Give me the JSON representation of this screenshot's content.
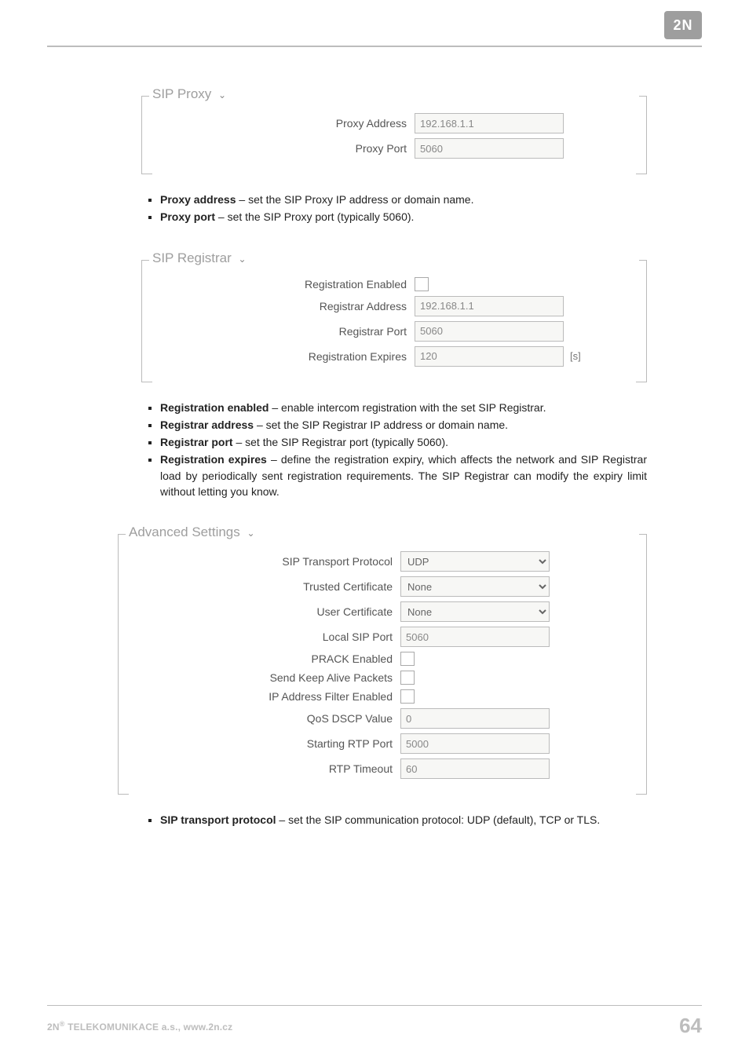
{
  "brand": {
    "logo_text": "2N"
  },
  "sections": {
    "sip_proxy": {
      "title": "SIP Proxy",
      "fields": {
        "proxy_address_label": "Proxy Address",
        "proxy_address_value": "192.168.1.1",
        "proxy_port_label": "Proxy Port",
        "proxy_port_value": "5060"
      },
      "desc": [
        {
          "term": "Proxy address",
          "text": " – set the SIP Proxy IP address or domain name."
        },
        {
          "term": "Proxy port",
          "text": " – set the SIP Proxy port (typically 5060)."
        }
      ]
    },
    "sip_registrar": {
      "title": "SIP Registrar",
      "fields": {
        "registration_enabled_label": "Registration Enabled",
        "registrar_address_label": "Registrar Address",
        "registrar_address_value": "192.168.1.1",
        "registrar_port_label": "Registrar Port",
        "registrar_port_value": "5060",
        "registration_expires_label": "Registration Expires",
        "registration_expires_value": "120",
        "registration_expires_suffix": "[s]"
      },
      "desc": [
        {
          "term": "Registration enabled",
          "text": " – enable intercom registration with the set SIP Registrar."
        },
        {
          "term": "Registrar address",
          "text": " – set the SIP Registrar IP address or domain name."
        },
        {
          "term": "Registrar port",
          "text": " – set the SIP Registrar port (typically 5060)."
        },
        {
          "term": "Registration expires",
          "text": " – define the registration expiry, which affects the network and SIP Registrar load by periodically sent registration requirements. The SIP Registrar can modify the expiry limit without letting you know."
        }
      ]
    },
    "advanced": {
      "title": "Advanced Settings",
      "fields": {
        "sip_transport_label": "SIP Transport Protocol",
        "sip_transport_value": "UDP",
        "trusted_cert_label": "Trusted Certificate",
        "trusted_cert_value": "None",
        "user_cert_label": "User Certificate",
        "user_cert_value": "None",
        "local_sip_port_label": "Local SIP Port",
        "local_sip_port_value": "5060",
        "prack_enabled_label": "PRACK Enabled",
        "keep_alive_label": "Send Keep Alive Packets",
        "ip_filter_label": "IP Address Filter Enabled",
        "qos_dscp_label": "QoS DSCP Value",
        "qos_dscp_value": "0",
        "starting_rtp_label": "Starting RTP Port",
        "starting_rtp_value": "5000",
        "rtp_timeout_label": "RTP Timeout",
        "rtp_timeout_value": "60"
      },
      "desc": [
        {
          "term": "SIP transport protocol",
          "text": " – set the SIP communication protocol: UDP (default), TCP or TLS."
        }
      ]
    }
  },
  "footer": {
    "company": "2N",
    "reg": "®",
    "rest": " TELEKOMUNIKACE a.s., www.2n.cz",
    "page": "64"
  }
}
